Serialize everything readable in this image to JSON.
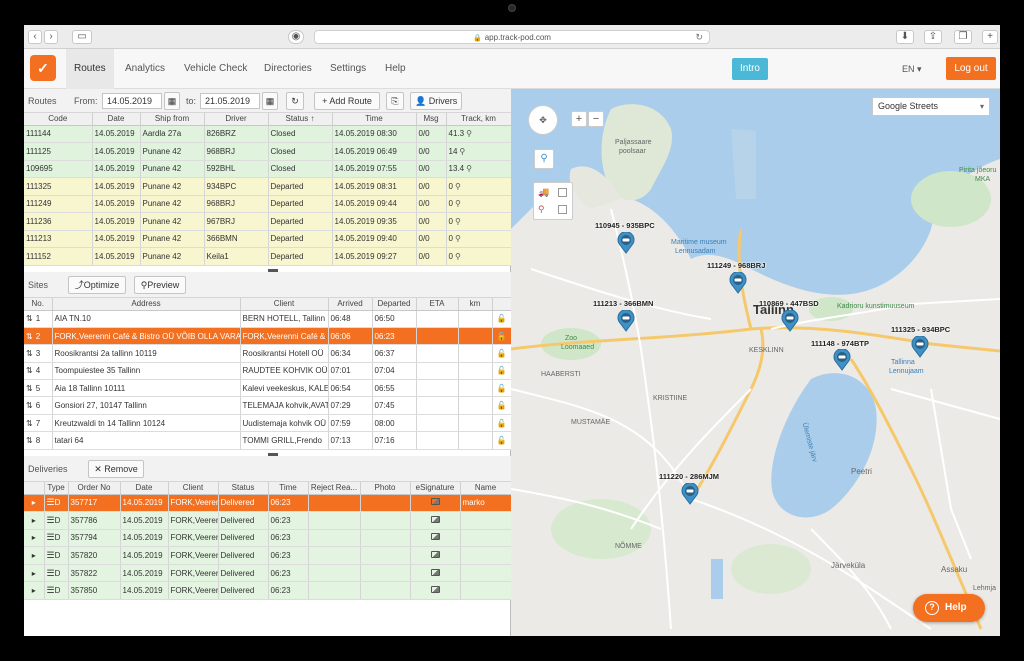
{
  "browser": {
    "url": "app.track-pod.com"
  },
  "header": {
    "nav": [
      "Routes",
      "Analytics",
      "Vehicle Check",
      "Directories",
      "Settings",
      "Help"
    ],
    "intro": "Intro",
    "lang": "EN",
    "logout": "Log out"
  },
  "routes": {
    "label": "Routes",
    "from_label": "From:",
    "from": "14.05.2019",
    "to_label": "to:",
    "to": "21.05.2019",
    "add_route": "Add Route",
    "drivers": "Drivers",
    "columns": [
      "Code",
      "Date",
      "Ship from",
      "Driver",
      "Status",
      "Time",
      "Msg",
      "Track, km"
    ],
    "rows": [
      {
        "status_class": "closed",
        "cells": [
          "111144",
          "14.05.2019",
          "Aardla 27a",
          "826BRZ",
          "Closed",
          "14.05.2019 08:30",
          "0/0",
          "41.3"
        ]
      },
      {
        "status_class": "closed",
        "cells": [
          "111125",
          "14.05.2019",
          "Punane 42",
          "968BRJ",
          "Closed",
          "14.05.2019 06:49",
          "0/0",
          "14"
        ]
      },
      {
        "status_class": "closed",
        "cells": [
          "109695",
          "14.05.2019",
          "Punane 42",
          "592BHL",
          "Closed",
          "14.05.2019 07:55",
          "0/0",
          "13.4"
        ]
      },
      {
        "status_class": "departed",
        "cells": [
          "111325",
          "14.05.2019",
          "Punane 42",
          "934BPC",
          "Departed",
          "14.05.2019 08:31",
          "0/0",
          "0"
        ]
      },
      {
        "status_class": "departed",
        "cells": [
          "111249",
          "14.05.2019",
          "Punane 42",
          "968BRJ",
          "Departed",
          "14.05.2019 09:44",
          "0/0",
          "0"
        ]
      },
      {
        "status_class": "departed",
        "cells": [
          "111236",
          "14.05.2019",
          "Punane 42",
          "967BRJ",
          "Departed",
          "14.05.2019 09:35",
          "0/0",
          "0"
        ]
      },
      {
        "status_class": "departed",
        "cells": [
          "111213",
          "14.05.2019",
          "Punane 42",
          "366BMN",
          "Departed",
          "14.05.2019 09:40",
          "0/0",
          "0"
        ]
      },
      {
        "status_class": "departed",
        "cells": [
          "111152",
          "14.05.2019",
          "Punane 42",
          "Keila1",
          "Departed",
          "14.05.2019 09:27",
          "0/0",
          "0"
        ]
      }
    ]
  },
  "sites": {
    "label": "Sites",
    "optimize": "Optimize",
    "preview": "Preview",
    "columns": [
      "No.",
      "Address",
      "Client",
      "Arrived",
      "Departed",
      "ETA",
      "km"
    ],
    "rows": [
      {
        "no": "1",
        "address": "AIA TN.10",
        "client": "BERN HOTELL, Tallinn",
        "arrived": "06:48",
        "departed": "06:50",
        "sel": false
      },
      {
        "no": "2",
        "address": "FORK,Veerenni Café & Bistro OÜ VÕIB OLLA VARA",
        "client": "FORK,Veerenni Café & Bistro",
        "arrived": "06:06",
        "departed": "06:23",
        "sel": true
      },
      {
        "no": "3",
        "address": "Roosikrantsi 2a tallinn 10119",
        "client": "Roosikrantsi Hotell OÜ",
        "arrived": "06:34",
        "departed": "06:37",
        "sel": false
      },
      {
        "no": "4",
        "address": "Toompuiestee 35 Tallinn",
        "client": "RAUDTEE KOHVIK OÜ",
        "arrived": "07:01",
        "departed": "07:04",
        "sel": false
      },
      {
        "no": "5",
        "address": "Aia 18 Tallinn 10111",
        "client": "Kalevi veekeskus, KALEVI",
        "arrived": "06:54",
        "departed": "06:55",
        "sel": false
      },
      {
        "no": "6",
        "address": "Gonsiori 27, 10147 Tallinn",
        "client": "TELEMAJA kohvik,AVAT",
        "arrived": "07:29",
        "departed": "07:45",
        "sel": false
      },
      {
        "no": "7",
        "address": "Kreutzwaldi tn 14 Tallinn 10124",
        "client": "Uudistemaja kohvik OÜ",
        "arrived": "07:59",
        "departed": "08:00",
        "sel": false
      },
      {
        "no": "8",
        "address": "tatari 64",
        "client": "TOMMI GRILL,Frendo",
        "arrived": "07:13",
        "departed": "07:16",
        "sel": false
      }
    ]
  },
  "deliveries": {
    "label": "Deliveries",
    "remove": "Remove",
    "columns": [
      "Type",
      "Order No",
      "Date",
      "Client",
      "Status",
      "Time",
      "Reject Rea...",
      "Photo",
      "eSignature",
      "Name"
    ],
    "rows": [
      {
        "type": "D",
        "order": "357717",
        "date": "14.05.2019",
        "client": "FORK,Veerenni",
        "status": "Delivered",
        "time": "06:23",
        "name": "marko",
        "sel": true
      },
      {
        "type": "D",
        "order": "357786",
        "date": "14.05.2019",
        "client": "FORK,Veerenni",
        "status": "Delivered",
        "time": "06:23",
        "name": "",
        "sel": false
      },
      {
        "type": "D",
        "order": "357794",
        "date": "14.05.2019",
        "client": "FORK,Veerenni",
        "status": "Delivered",
        "time": "06:23",
        "name": "",
        "sel": false
      },
      {
        "type": "D",
        "order": "357820",
        "date": "14.05.2019",
        "client": "FORK,Veerenni",
        "status": "Delivered",
        "time": "06:23",
        "name": "",
        "sel": false
      },
      {
        "type": "D",
        "order": "357822",
        "date": "14.05.2019",
        "client": "FORK,Veerenni",
        "status": "Delivered",
        "time": "06:23",
        "name": "",
        "sel": false
      },
      {
        "type": "D",
        "order": "357850",
        "date": "14.05.2019",
        "client": "FORK,Veerenni",
        "status": "Delivered",
        "time": "06:23",
        "name": "",
        "sel": false
      }
    ]
  },
  "map": {
    "type": "Google Streets",
    "markers": [
      "110945 - 935BPC",
      "111249 - 968BRJ",
      "111213 - 366BMN",
      "110869 - 447BSD",
      "111148 - 974BTP",
      "111325 - 934BPC",
      "111220 - 286MJM"
    ],
    "labels": {
      "city": "Tallinn",
      "paljassaare": "Paljassaare",
      "poolsaar": "poolsaar",
      "maritime": "Maritime museum",
      "lennusadam": "Lennusadam",
      "kadriorg": "Kadrioru kunstimuuseum",
      "zoo": "Zoo",
      "loomaaed": "Loomaaed",
      "airport": "Tallinna",
      "airport2": "Lennujaam",
      "lake": "Ülemiste järv",
      "peetri": "Peetri",
      "jarvekula": "Järveküla",
      "assaku": "Assaku",
      "pirita": "Pirita jõeoru",
      "pirita2": "MKA",
      "haabersti": "HAABERSTI",
      "mustamae": "MUSTAMÄE",
      "nomme": "NÕMME",
      "kristiine": "KRISTIINE",
      "kesklinn": "KESKLINN",
      "lehmja": "Lehmja"
    },
    "help": "Help"
  },
  "colors": {
    "accent": "#f37021",
    "intro": "#4ab8d6",
    "closed_row": "#dff3dd",
    "departed_row": "#f8f6cf",
    "water": "#a9cdea",
    "marker": "#3d91c7"
  }
}
